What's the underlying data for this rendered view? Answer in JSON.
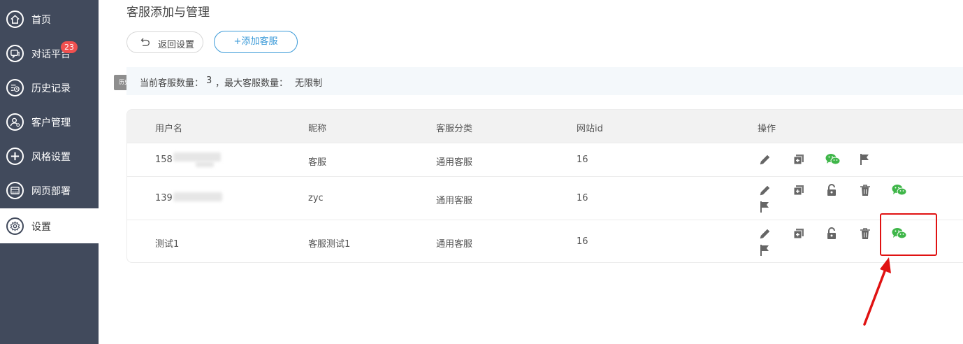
{
  "sidebar": {
    "items": [
      {
        "label": "首页",
        "icon": "home-icon"
      },
      {
        "label": "对话平台",
        "icon": "chat-icon"
      },
      {
        "label": "历史记录",
        "icon": "history-icon"
      },
      {
        "label": "客户管理",
        "icon": "customer-icon"
      },
      {
        "label": "风格设置",
        "icon": "plus-icon"
      },
      {
        "label": "网页部署",
        "icon": "deploy-icon"
      },
      {
        "label": "设置",
        "icon": "gear-icon"
      }
    ],
    "chat_badge": "23",
    "tooltip": "历史记录",
    "active": "设置"
  },
  "page": {
    "title": "客服添加与管理",
    "back_button": "返回设置",
    "add_button": "+添加客服"
  },
  "info": {
    "current_label": "当前客服数量：",
    "current_value": "3",
    "max_label": "，最大客服数量：",
    "max_value": "无限制"
  },
  "table": {
    "headers": [
      "用户名",
      "昵称",
      "客服分类",
      "网站id",
      "操作"
    ],
    "rows": [
      {
        "username": "158",
        "nickname": "客服",
        "category": "通用客服",
        "site_id": "16"
      },
      {
        "username": "139",
        "nickname": "zyc",
        "category": "通用客服",
        "site_id": "16"
      },
      {
        "username": "测试1",
        "nickname": "客服测试1",
        "category": "通用客服",
        "site_id": "16"
      }
    ]
  },
  "colors": {
    "sidebar_bg": "#414a5c",
    "accent_blue": "#3b9ad8",
    "wechat_green": "#3fb649",
    "badge_red": "#f0504f",
    "annotation_red": "#e01212"
  }
}
